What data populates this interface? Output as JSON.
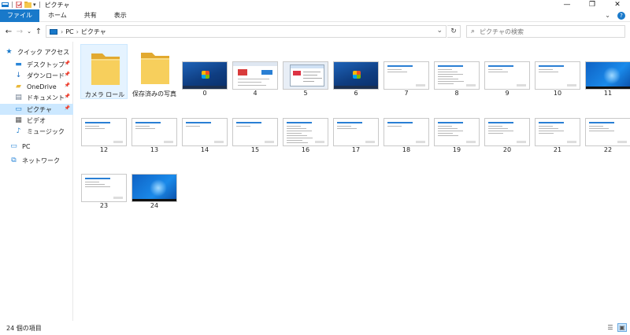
{
  "window": {
    "title": "ピクチャ",
    "controls": {
      "minimize": "—",
      "maximize": "❐",
      "close": "✕"
    }
  },
  "ribbon": {
    "tabs": [
      "ファイル",
      "ホーム",
      "共有",
      "表示"
    ],
    "expand_icon": "⌄",
    "help_icon": "?"
  },
  "address": {
    "crumbs": [
      "PC",
      "ピクチャ"
    ],
    "search_placeholder": "ピクチャの検索"
  },
  "nav": {
    "items": [
      {
        "label": "クイック アクセス",
        "icon": "star-icon",
        "pinned": false,
        "selected": false
      },
      {
        "label": "デスクトップ",
        "icon": "desktop-icon",
        "pinned": true,
        "selected": false
      },
      {
        "label": "ダウンロード",
        "icon": "download-icon",
        "pinned": true,
        "selected": false
      },
      {
        "label": "OneDrive",
        "icon": "folder-icon",
        "pinned": true,
        "selected": false
      },
      {
        "label": "ドキュメント",
        "icon": "document-icon",
        "pinned": true,
        "selected": false
      },
      {
        "label": "ピクチャ",
        "icon": "pictures-icon",
        "pinned": true,
        "selected": true
      },
      {
        "label": "ビデオ",
        "icon": "video-icon",
        "pinned": false,
        "selected": false
      },
      {
        "label": "ミュージック",
        "icon": "music-icon",
        "pinned": false,
        "selected": false
      },
      {
        "label": "PC",
        "icon": "pc-icon",
        "pinned": false,
        "selected": false
      },
      {
        "label": "ネットワーク",
        "icon": "network-icon",
        "pinned": false,
        "selected": false
      }
    ]
  },
  "files": [
    {
      "label": "カメラ ロール",
      "kind": "folder",
      "selected": true
    },
    {
      "label": "保存済みの写真",
      "kind": "folder",
      "selected": false
    },
    {
      "label": "0",
      "kind": "win7"
    },
    {
      "label": "4",
      "kind": "browser"
    },
    {
      "label": "5",
      "kind": "dialog"
    },
    {
      "label": "6",
      "kind": "win7"
    },
    {
      "label": "7",
      "kind": "doc",
      "lines": 2
    },
    {
      "label": "8",
      "kind": "doc",
      "lines": 7
    },
    {
      "label": "9",
      "kind": "doc",
      "lines": 2
    },
    {
      "label": "10",
      "kind": "doc",
      "lines": 2
    },
    {
      "label": "11",
      "kind": "win10"
    },
    {
      "label": "12",
      "kind": "doc",
      "lines": 2
    },
    {
      "label": "13",
      "kind": "doc",
      "lines": 2
    },
    {
      "label": "14",
      "kind": "doc",
      "lines": 1
    },
    {
      "label": "15",
      "kind": "doc",
      "lines": 1
    },
    {
      "label": "16",
      "kind": "doc",
      "lines": 8
    },
    {
      "label": "17",
      "kind": "doc",
      "lines": 2
    },
    {
      "label": "18",
      "kind": "doc",
      "lines": 1
    },
    {
      "label": "19",
      "kind": "doc",
      "lines": 5
    },
    {
      "label": "20",
      "kind": "doc",
      "lines": 4
    },
    {
      "label": "21",
      "kind": "doc",
      "lines": 4
    },
    {
      "label": "22",
      "kind": "doc",
      "lines": 3
    },
    {
      "label": "23",
      "kind": "doc",
      "lines": 3
    },
    {
      "label": "24",
      "kind": "win10"
    }
  ],
  "status": {
    "item_count": "24 個の項目"
  },
  "colors": {
    "accent": "#1979ca",
    "selection": "#cce8ff"
  }
}
